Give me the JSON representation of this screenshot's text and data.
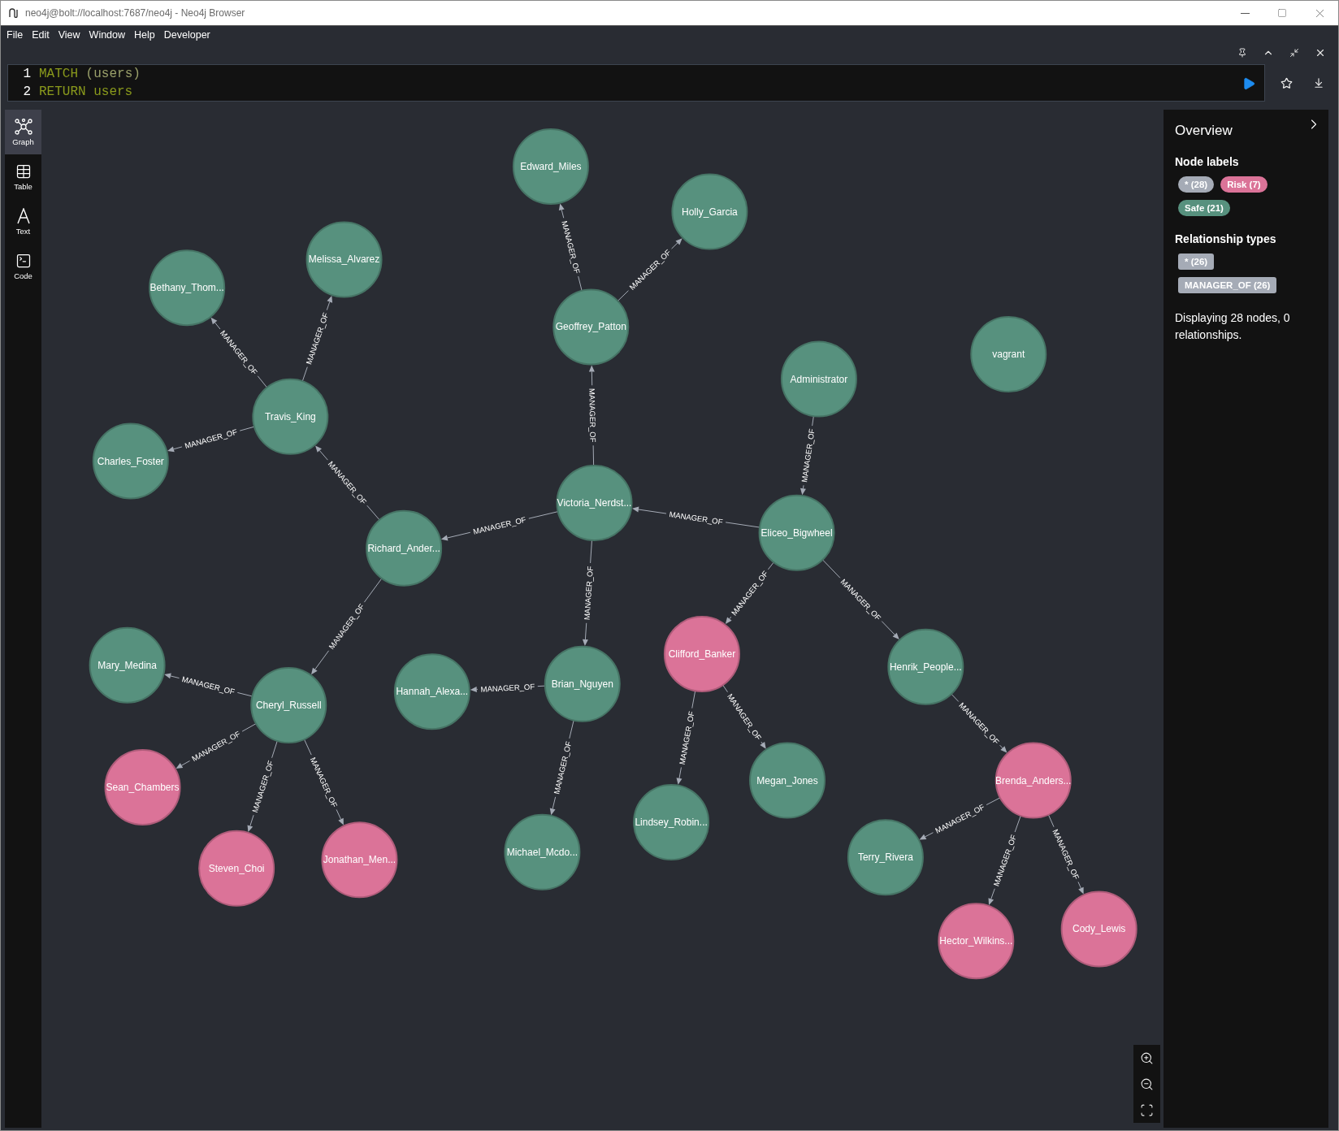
{
  "window": {
    "title": "neo4j@bolt://localhost:7687/neo4j - Neo4j Browser"
  },
  "menu": [
    "File",
    "Edit",
    "View",
    "Window",
    "Help",
    "Developer"
  ],
  "editor": {
    "lines": [
      {
        "number": "1",
        "tokens": [
          {
            "text": "MATCH",
            "kind": "keyword"
          },
          {
            "text": "(users)",
            "kind": "plain"
          }
        ]
      },
      {
        "number": "2",
        "tokens": [
          {
            "text": "RETURN",
            "kind": "keyword"
          },
          {
            "text": "users",
            "kind": "keyword"
          }
        ]
      }
    ]
  },
  "views": [
    {
      "label": "Graph",
      "kind": "graph",
      "selected": true
    },
    {
      "label": "Table",
      "kind": "table",
      "selected": false
    },
    {
      "label": "Text",
      "kind": "text",
      "selected": false
    },
    {
      "label": "Code",
      "kind": "code",
      "selected": false
    }
  ],
  "graph": {
    "nodes": [
      {
        "name": "Administrator",
        "color": "#57917e",
        "children": [
          {
            "name": "Eliceo_Bigwheel",
            "color": "#57917e",
            "edge_label": "MANAGER_OF",
            "children": [
              {
                "name": "Victoria_Nerdst...",
                "color": "#57917e",
                "edge_label": "MANAGER_OF",
                "children": [
                  {
                    "name": "Geoffrey_Patton",
                    "color": "#57917e",
                    "edge_label": "MANAGER_OF",
                    "children": [
                      {
                        "name": "Edward_Miles",
                        "color": "#57917e",
                        "edge_label": "MANAGER_OF"
                      },
                      {
                        "name": "Holly_Garcia",
                        "color": "#57917e",
                        "edge_label": "MANAGER_OF"
                      }
                    ]
                  },
                  {
                    "name": "Richard_Ander...",
                    "color": "#57917e",
                    "edge_label": "MANAGER_OF",
                    "children": [
                      {
                        "name": "Travis_King",
                        "color": "#57917e",
                        "edge_label": "MANAGER_OF",
                        "children": [
                          {
                            "name": "Bethany_Thom...",
                            "color": "#57917e",
                            "edge_label": "MANAGER_OF"
                          },
                          {
                            "name": "Melissa_Alvarez",
                            "color": "#57917e",
                            "edge_label": "MANAGER_OF"
                          },
                          {
                            "name": "Charles_Foster",
                            "color": "#57917e",
                            "edge_label": "MANAGER_OF"
                          }
                        ]
                      },
                      {
                        "name": "Cheryl_Russell",
                        "color": "#57917e",
                        "edge_label": "MANAGER_OF",
                        "children": [
                          {
                            "name": "Mary_Medina",
                            "color": "#57917e",
                            "edge_label": "MANAGER_OF"
                          },
                          {
                            "name": "Sean_Chambers",
                            "color": "#db7398",
                            "edge_label": "MANAGER_OF"
                          },
                          {
                            "name": "Steven_Choi",
                            "color": "#db7398",
                            "edge_label": "MANAGER_OF"
                          },
                          {
                            "name": "Jonathan_Men...",
                            "color": "#db7398",
                            "edge_label": "MANAGER_OF"
                          }
                        ]
                      }
                    ]
                  },
                  {
                    "name": "Brian_Nguyen",
                    "color": "#57917e",
                    "edge_label": "MANAGER_OF",
                    "children": [
                      {
                        "name": "Hannah_Alexa...",
                        "color": "#57917e",
                        "edge_label": "MANAGER_OF"
                      },
                      {
                        "name": "Michael_Mcdo...",
                        "color": "#57917e",
                        "edge_label": "MANAGER_OF"
                      }
                    ]
                  }
                ]
              },
              {
                "name": "Clifford_Banker",
                "color": "#db7398",
                "edge_label": "MANAGER_OF",
                "children": [
                  {
                    "name": "Lindsey_Robin...",
                    "color": "#57917e",
                    "edge_label": "MANAGER_OF"
                  },
                  {
                    "name": "Megan_Jones",
                    "color": "#57917e",
                    "edge_label": "MANAGER_OF"
                  }
                ]
              },
              {
                "name": "Henrik_People...",
                "color": "#57917e",
                "edge_label": "MANAGER_OF",
                "children": [
                  {
                    "name": "Brenda_Anders...",
                    "color": "#db7398",
                    "edge_label": "MANAGER_OF",
                    "children": [
                      {
                        "name": "Terry_Rivera",
                        "color": "#57917e",
                        "edge_label": "MANAGER_OF"
                      },
                      {
                        "name": "Hector_Wilkins...",
                        "color": "#db7398",
                        "edge_label": "MANAGER_OF"
                      },
                      {
                        "name": "Cody_Lewis",
                        "color": "#db7398",
                        "edge_label": "MANAGER_OF"
                      }
                    ]
                  }
                ]
              }
            ]
          }
        ]
      },
      {
        "name": "vagrant",
        "color": "#57917e"
      }
    ]
  },
  "overview": {
    "title": "Overview",
    "node_labels": {
      "heading": "Node labels",
      "items": [
        {
          "text": "* (28)",
          "color": "#a5abb6"
        },
        {
          "text": "Risk (7)",
          "color": "#db7398"
        },
        {
          "text": "Safe (21)",
          "color": "#57917e"
        }
      ]
    },
    "relationship_types": {
      "heading": "Relationship types",
      "items": [
        {
          "text": "* (26)",
          "color": "#a5abb6"
        },
        {
          "text": "MANAGER_OF (26)",
          "color": "#a5abb6"
        }
      ]
    },
    "summary": "Displaying 28 nodes, 0 relationships."
  }
}
